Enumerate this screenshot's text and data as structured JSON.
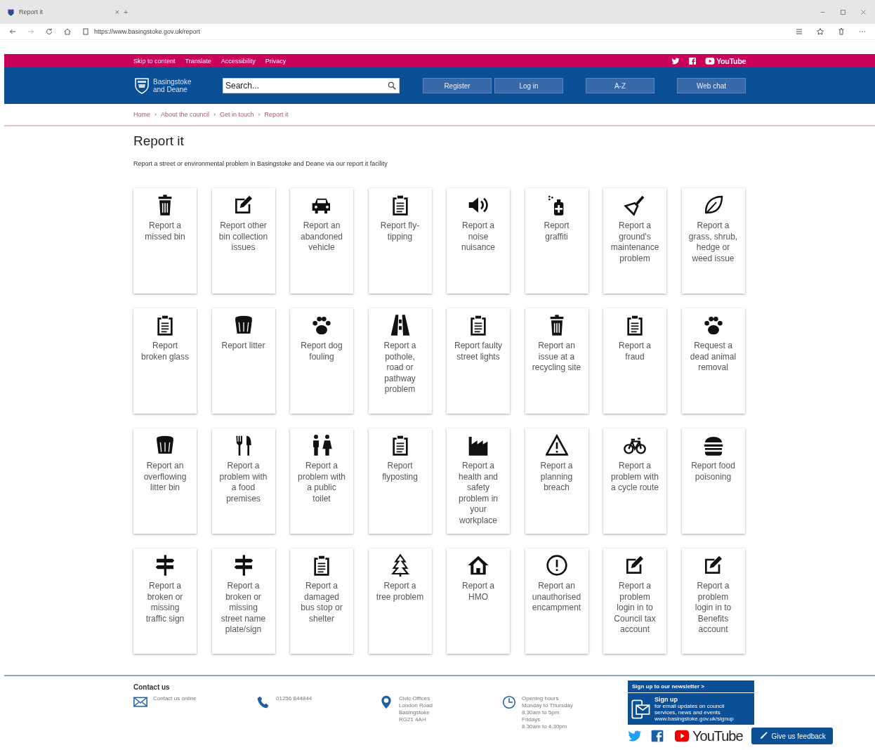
{
  "browser": {
    "tab_title": "Report it",
    "close_tab": "×",
    "new_tab": "+",
    "url": "https://www.basingstoke.gov.uk/report"
  },
  "top_links": [
    "Skip to content",
    "Translate",
    "Accessibility",
    "Privacy"
  ],
  "top_social": {
    "youtube": "YouTube"
  },
  "logo": {
    "line_1": "Basingstoke",
    "line_2": "and Deane"
  },
  "search": {
    "placeholder": "Search..."
  },
  "header_buttons": [
    "Register",
    "Log in",
    "A-Z",
    "Web chat"
  ],
  "breadcrumb": [
    {
      "label": "Home",
      "separator": "›"
    },
    {
      "label": "About the council",
      "separator": "›"
    },
    {
      "label": "Get in touch",
      "separator": "›"
    },
    {
      "label": "Report it"
    }
  ],
  "heading": "Report it",
  "intro": "Report a street or environmental problem in Basingstoke and Deane via our report it facility",
  "cards": [
    {
      "kind": "bin",
      "label": "Report a missed bin"
    },
    {
      "kind": "edit",
      "label": "Report other bin collection issues"
    },
    {
      "kind": "car",
      "label": "Report an abandoned vehicle"
    },
    {
      "kind": "clipboard",
      "label": "Report fly-tipping"
    },
    {
      "kind": "speaker",
      "label": "Report a noise nuisance"
    },
    {
      "kind": "spray",
      "label": "Report graffiti"
    },
    {
      "kind": "broom",
      "label": "Report a ground's maintenance problem"
    },
    {
      "kind": "leaf",
      "label": "Report a grass, shrub, hedge or weed issue"
    },
    {
      "kind": "clipboard",
      "label": "Report broken glass"
    },
    {
      "kind": "litterbin",
      "label": "Report litter"
    },
    {
      "kind": "paw",
      "label": "Report dog fouling"
    },
    {
      "kind": "road",
      "label": "Report a pothole, road or pathway problem"
    },
    {
      "kind": "clipboard",
      "label": "Report faulty street lights"
    },
    {
      "kind": "bin",
      "label": "Report an issue at a recycling site"
    },
    {
      "kind": "clipboard",
      "label": "Report a fraud"
    },
    {
      "kind": "paw",
      "label": "Request a dead animal removal"
    },
    {
      "kind": "litterbin",
      "label": "Report an overflowing litter bin"
    },
    {
      "kind": "cutlery",
      "label": "Report a problem with a food premises"
    },
    {
      "kind": "toilet",
      "label": "Report a problem with a public toilet"
    },
    {
      "kind": "clipboard",
      "label": "Report flyposting"
    },
    {
      "kind": "factory",
      "label": "Report a health and safety problem in your workplace"
    },
    {
      "kind": "warning",
      "label": "Report a planning breach"
    },
    {
      "kind": "bike",
      "label": "Report a problem with a cycle route"
    },
    {
      "kind": "burger",
      "label": "Report food poisoning"
    },
    {
      "kind": "sign",
      "label": "Report a broken or missing traffic sign"
    },
    {
      "kind": "sign",
      "label": "Report a broken or missing street name plate/sign"
    },
    {
      "kind": "clipboard",
      "label": "Report a damaged bus stop or shelter"
    },
    {
      "kind": "tree",
      "label": "Report a tree problem"
    },
    {
      "kind": "house",
      "label": "Report a HMO"
    },
    {
      "kind": "alert",
      "label": "Report an unauthorised encampment"
    },
    {
      "kind": "edit",
      "label": "Report a problem login in to Council tax account"
    },
    {
      "kind": "edit",
      "label": "Report a problem login in to Benefits account"
    }
  ],
  "footer": {
    "heading": "Contact us",
    "contacts": [
      {
        "kind": "mail",
        "lines": [
          "Contact us online"
        ]
      },
      {
        "kind": "phone",
        "lines": [
          "01256 844844"
        ]
      },
      {
        "kind": "pin",
        "lines": [
          "Civic Offices",
          "London Road",
          "Basingstoke",
          "RG21 4AH"
        ]
      },
      {
        "kind": "clock",
        "lines": [
          "Opening hours",
          "Monday to Thursday",
          "8.30am to 5pm",
          "Fridays",
          "8.30am to 4.30pm"
        ]
      }
    ],
    "newsletter": {
      "title": "Sign up to our newsletter >",
      "heading": "Sign up",
      "lines": [
        "for email updates on council",
        "services, news and events",
        "www.basingstoke.gov.uk/signup"
      ]
    },
    "youtube": "YouTube",
    "feedback": "Give us feedback"
  }
}
